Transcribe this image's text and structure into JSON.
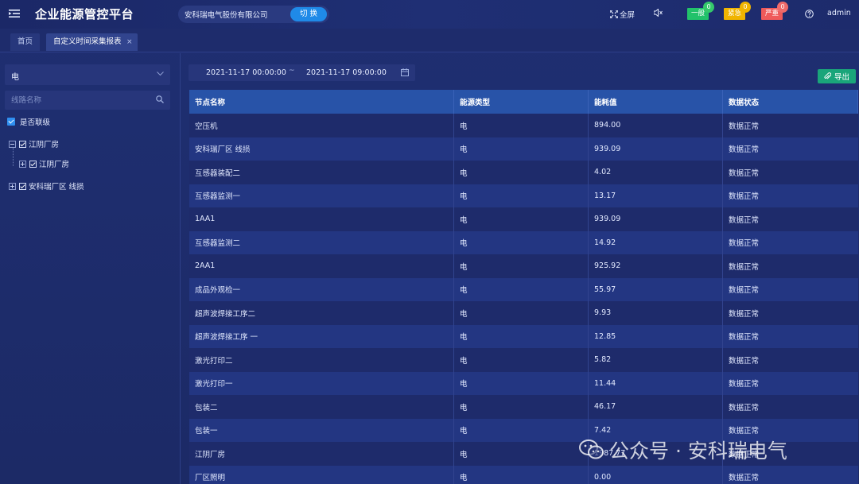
{
  "header": {
    "title": "企业能源管控平台",
    "company": "安科瑞电气股份有限公司",
    "switch_label": "切 换",
    "fullscreen_label": "全屏",
    "alarms": [
      {
        "label": "一般",
        "count": "0",
        "color": "#22c26a"
      },
      {
        "label": "紧急",
        "count": "0",
        "color": "#f0b400"
      },
      {
        "label": "严重",
        "count": "0",
        "color": "#ef5a5a"
      }
    ],
    "user": "admin"
  },
  "tabs": [
    {
      "label": "首页"
    },
    {
      "label": "自定义时间采集报表",
      "close": "×"
    }
  ],
  "sidebar": {
    "energy_select": "电",
    "search_placeholder": "线路名称",
    "cascade_label": "是否联级",
    "tree": [
      {
        "label": "江阴厂房",
        "expanded": true
      },
      {
        "label": "江阴厂房",
        "expanded": false
      },
      {
        "label": "安科瑞厂区 线损",
        "expanded": false
      }
    ]
  },
  "filter": {
    "start": "2021-11-17 00:00:00",
    "separator": "~",
    "end": "2021-11-17 09:00:00",
    "export_label": "导出"
  },
  "table": {
    "columns": [
      "节点名称",
      "能源类型",
      "能耗值",
      "数据状态"
    ],
    "rows": [
      [
        "空压机",
        "电",
        "894.00",
        "数据正常"
      ],
      [
        "安科瑞厂区 线损",
        "电",
        "939.09",
        "数据正常"
      ],
      [
        "互感器装配二",
        "电",
        "4.02",
        "数据正常"
      ],
      [
        "互感器监测一",
        "电",
        "13.17",
        "数据正常"
      ],
      [
        "1AA1",
        "电",
        "939.09",
        "数据正常"
      ],
      [
        "互感器监测二",
        "电",
        "14.92",
        "数据正常"
      ],
      [
        "2AA1",
        "电",
        "925.92",
        "数据正常"
      ],
      [
        "成品外观检一",
        "电",
        "55.97",
        "数据正常"
      ],
      [
        "超声波焊接工序二",
        "电",
        "9.93",
        "数据正常"
      ],
      [
        "超声波焊接工序 一",
        "电",
        "12.85",
        "数据正常"
      ],
      [
        "激光打印二",
        "电",
        "5.82",
        "数据正常"
      ],
      [
        "激光打印一",
        "电",
        "11.44",
        "数据正常"
      ],
      [
        "包装二",
        "电",
        "46.17",
        "数据正常"
      ],
      [
        "包装一",
        "电",
        "7.42",
        "数据正常"
      ],
      [
        "江阴厂房",
        "电",
        "1987.77",
        "数据正常"
      ],
      [
        "厂区照明",
        "电",
        "0.00",
        "数据正常"
      ]
    ]
  },
  "watermark": "公众号 · 安科瑞电气"
}
